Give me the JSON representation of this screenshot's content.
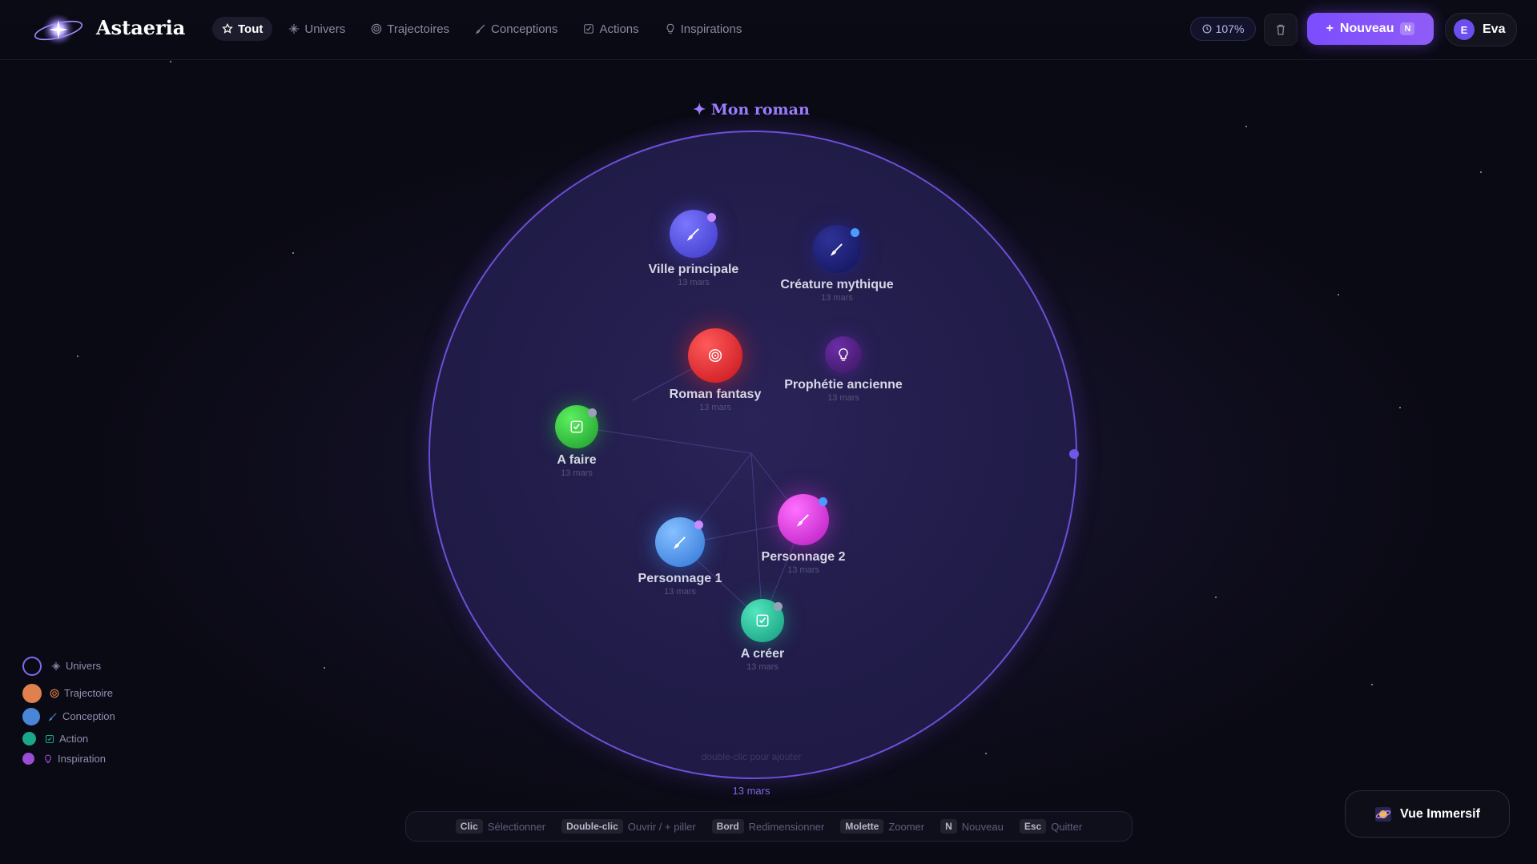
{
  "app": {
    "name": "Astaeria"
  },
  "nav": {
    "items": [
      {
        "label": "Tout",
        "icon": "star-icon",
        "active": true
      },
      {
        "label": "Univers",
        "icon": "sparkle-icon"
      },
      {
        "label": "Trajectoires",
        "icon": "target-icon"
      },
      {
        "label": "Conceptions",
        "icon": "brush-icon"
      },
      {
        "label": "Actions",
        "icon": "checkbox-icon"
      },
      {
        "label": "Inspirations",
        "icon": "lightbulb-icon"
      }
    ]
  },
  "toolbar": {
    "zoom": "107%",
    "new_label": "Nouveau",
    "new_key": "N"
  },
  "user": {
    "initial": "E",
    "name": "Eva"
  },
  "universe": {
    "title": "✦ Mon roman",
    "date": "13 mars",
    "hint": "double-clic pour ajouter"
  },
  "nodes": [
    {
      "label": "Ville principale",
      "date": "13 mars",
      "type": "conception",
      "icon": "brush-icon",
      "color": "#4a45d8",
      "badge": "#c98bff"
    },
    {
      "label": "Créature mythique",
      "date": "13 mars",
      "type": "conception",
      "icon": "brush-icon",
      "color": "#1d1f6e",
      "badge": "#4a9bff"
    },
    {
      "label": "Roman fantasy",
      "date": "13 mars",
      "type": "trajectoire",
      "icon": "target-icon",
      "color": "#e01f27",
      "badge": ""
    },
    {
      "label": "Prophétie ancienne",
      "date": "13 mars",
      "type": "inspiration",
      "icon": "lightbulb-icon",
      "color": "#4b1d7a",
      "badge": ""
    },
    {
      "label": "A faire",
      "date": "13 mars",
      "type": "action",
      "icon": "checkbox-icon",
      "color": "#25b53a",
      "badge": "#9aa0b8"
    },
    {
      "label": "Personnage 1",
      "date": "13 mars",
      "type": "conception",
      "icon": "brush-icon",
      "color": "#3d8bf0",
      "badge": "#c98bff"
    },
    {
      "label": "Personnage 2",
      "date": "13 mars",
      "type": "conception",
      "icon": "brush-icon",
      "color": "#d12ad6",
      "badge": "#4a9bff"
    },
    {
      "label": "A créer",
      "date": "13 mars",
      "type": "action",
      "icon": "checkbox-icon",
      "color": "#1aa88a",
      "badge": "#9aa0b8"
    }
  ],
  "legend": [
    {
      "label": "Univers",
      "icon": "sparkle-icon",
      "color": "#7a6cf0"
    },
    {
      "label": "Trajectoire",
      "icon": "target-icon",
      "color": "#e0804c"
    },
    {
      "label": "Conception",
      "icon": "brush-icon",
      "color": "#4a86d8"
    },
    {
      "label": "Action",
      "icon": "checkbox-icon",
      "color": "#1aa88a"
    },
    {
      "label": "Inspiration",
      "icon": "lightbulb-icon",
      "color": "#9a4ed6"
    }
  ],
  "shortcuts": [
    {
      "key": "Clic",
      "action": "Sélectionner"
    },
    {
      "key": "Double-clic",
      "action": "Ouvrir / + piller"
    },
    {
      "key": "Bord",
      "action": "Redimensionner"
    },
    {
      "key": "Molette",
      "action": "Zoomer"
    },
    {
      "key": "N",
      "action": "Nouveau"
    },
    {
      "key": "Esc",
      "action": "Quitter"
    }
  ],
  "immersive": {
    "label": "Vue Immersif",
    "icon": "galaxy-icon"
  }
}
